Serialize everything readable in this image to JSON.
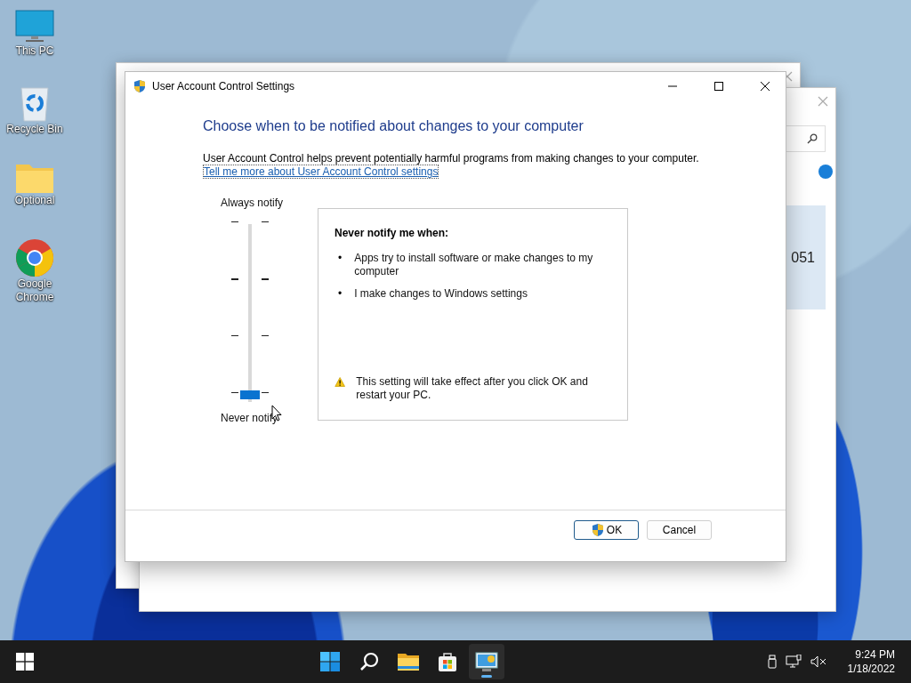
{
  "desktop_icons": [
    {
      "label": "This PC",
      "kind": "pc"
    },
    {
      "label": "Recycle Bin",
      "kind": "bin"
    },
    {
      "label": "Optional",
      "kind": "folder"
    },
    {
      "label": "Google Chrome",
      "kind": "chrome"
    }
  ],
  "background_window": {
    "text": "051"
  },
  "dialog": {
    "title": "User Account Control Settings",
    "heading": "Choose when to be notified about changes to your computer",
    "description": "User Account Control helps prevent potentially harmful programs from making changes to your computer.",
    "link": "Tell me more about User Account Control settings",
    "slider": {
      "top_label": "Always notify",
      "bottom_label": "Never notify",
      "level": 0
    },
    "info": {
      "title": "Never notify me when:",
      "bullets": [
        {
          "marker": "•",
          "text": "Apps try to install software or make changes to my computer"
        },
        {
          "marker": "•",
          "text": "I make changes to Windows settings"
        }
      ],
      "warning": "This setting will take effect after you click OK and restart your PC."
    },
    "buttons": [
      {
        "label": "OK",
        "kind": "shield",
        "focused": true
      },
      {
        "label": "Cancel",
        "kind": "plain",
        "focused": false
      }
    ]
  },
  "taskbar": {
    "apps": [
      {
        "kind": "start",
        "selected": false
      },
      {
        "kind": "search",
        "selected": false
      },
      {
        "kind": "explorer",
        "selected": false
      },
      {
        "kind": "store",
        "selected": false
      },
      {
        "kind": "uac",
        "selected": true
      }
    ],
    "time": "9:24 PM",
    "date": "1/18/2022"
  }
}
